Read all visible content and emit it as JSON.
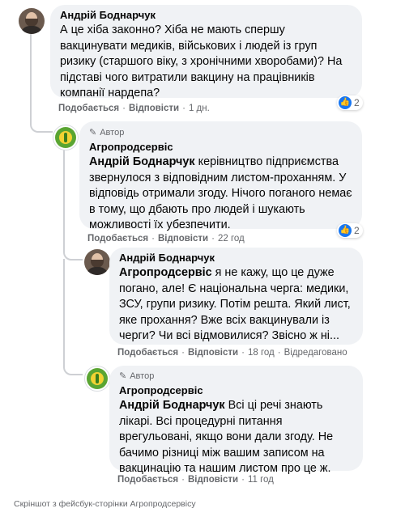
{
  "comments": [
    {
      "author": "Андрій Боднарчук",
      "text": "А це хіба законно? Хіба не мають спершу вакцинувати медиків, військових і людей із груп ризику (старшого віку, з хронічними хворобами)? На підставі чого витратили вакцину на працівників компанії нардепа?",
      "like": "Подобається",
      "reply": "Відповісти",
      "time": "1 дн.",
      "reactions": "2"
    },
    {
      "badge": "Автор",
      "author": "Агропродсервіс",
      "tag": "Андрій Боднарчук",
      "text": "керівництво підприємства звернулося з відповідним листом-проханням. У відповідь отримали згоду. Нічого поганого немає в тому, що дбають про людей і шукають можливості їх убезпечити.",
      "like": "Подобається",
      "reply": "Відповісти",
      "time": "22 год",
      "reactions": "2"
    },
    {
      "author": "Андрій Боднарчук",
      "tag": "Агропродсервіс",
      "text": "я не кажу, що це дуже погано, але! Є національна черга: медики, ЗСУ, групи ризику. Потім решта. Який лист, яке прохання? Вже всіх вакцинували із черги? Чи всі відмовилися? Звісно ж ні...",
      "like": "Подобається",
      "reply": "Відповісти",
      "time": "18 год",
      "edited": "Відредаговано"
    },
    {
      "badge": "Автор",
      "author": "Агропродсервіс",
      "tag": "Андрій Боднарчук",
      "text": "Всі ці речі знають лікарі. Всі процедурні питання врегульовані, якщо вони дали згоду. Не бачимо різниці між вашим записом на вакцинацію та нашим листом про це ж.",
      "like": "Подобається",
      "reply": "Відповісти",
      "time": "11 год"
    }
  ],
  "caption": "Скріншот з фейсбук-сторінки Агропродсервісу",
  "colors": {
    "bubble": "#f0f2f5",
    "meta": "#65676b",
    "like": "#1877f2",
    "text": "#050505"
  },
  "icons": {
    "like": "thumbs-up-icon",
    "badge": "pen-icon"
  }
}
